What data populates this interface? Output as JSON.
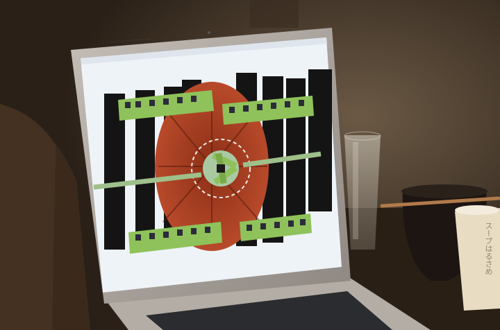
{
  "scene": {
    "description_free": true,
    "palette": {
      "room_dark": "#2a2017",
      "wall_warm": "#5b4a38",
      "laptop_silver": "#a7a09a",
      "screen_bg": "#eef3f8",
      "artwork_red": "#9e3b20",
      "train_green": "#8fc25a",
      "silhouette_black": "#151414",
      "keyboard_dark": "#2b2c2f"
    }
  },
  "screen": {
    "menubar_text": "· · ·  ·····  ··· ····  ···  ······ ·····  ·····"
  },
  "objects": {
    "cup_label": "スープはるさめ"
  }
}
